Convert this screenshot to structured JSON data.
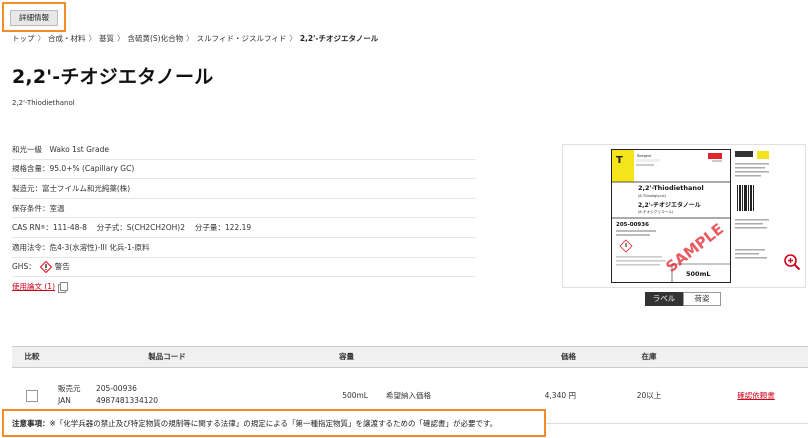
{
  "detail_button": "詳細情報",
  "breadcrumb": {
    "items": [
      "トップ",
      "合成・材料",
      "基質",
      "含硫黄(S)化合物",
      "スルフィド・ジスルフィド"
    ],
    "current": "2,2'-チオジエタノール",
    "separator": "〉"
  },
  "title": "2,2'-チオジエタノール",
  "subtitle": "2,2'-Thiodiethanol",
  "specs": {
    "grade": "和光一級　Wako 1st Grade",
    "purity": "規格含量：95.0+% (Capillary GC)",
    "manufacturer": "製造元：富士フイルム和光純薬(株)",
    "storage": "保存条件：室温",
    "cas_label": "CAS RN",
    "cas_rest": "：111-48-8　 分子式：S(CH2CH2OH)2　 分子量：122.19",
    "law": "適用法令：危4-3(水溶性)-III 化兵-1-原料",
    "ghs_label": "GHS：",
    "ghs_signal": "警告",
    "papers": "使用論文 (1)"
  },
  "label_image": {
    "header_text": "Reagent",
    "name_en": "2,2'-Thiodiethanol",
    "name_en2": "(β-Thiodiglycol)",
    "name_ja": "2,2'-チオジエタノール",
    "name_ja2": "(β-チオジグリコール)",
    "code": "205-00936",
    "volume": "500mL",
    "watermark": "SAMPLE"
  },
  "image_tabs": [
    "ラベル",
    "荷姿"
  ],
  "table": {
    "headers": {
      "compare": "比較",
      "code": "製品コード",
      "qty": "容量",
      "price": "価格",
      "stock": "在庫"
    },
    "row": {
      "seller_label": "販売元",
      "seller_code": "205-00936",
      "jan_label": "JAN",
      "jan_code": "4987481334120",
      "qty": "500mL",
      "price_type": "希望納入価格",
      "price": "4,340 円",
      "stock": "20以上",
      "action": "確認依頼書"
    }
  },
  "notice": {
    "label": "注意事項：",
    "text": "※「化学兵器の禁止及び特定物質の規制等に関する法律」の規定による「第一種指定物質」を譲渡するための「確認書」が必要です。"
  },
  "colors": {
    "highlight": "#f28c28",
    "link": "#d0021b",
    "label_yellow": "#f5e31c",
    "watermark": "#e0242b"
  }
}
